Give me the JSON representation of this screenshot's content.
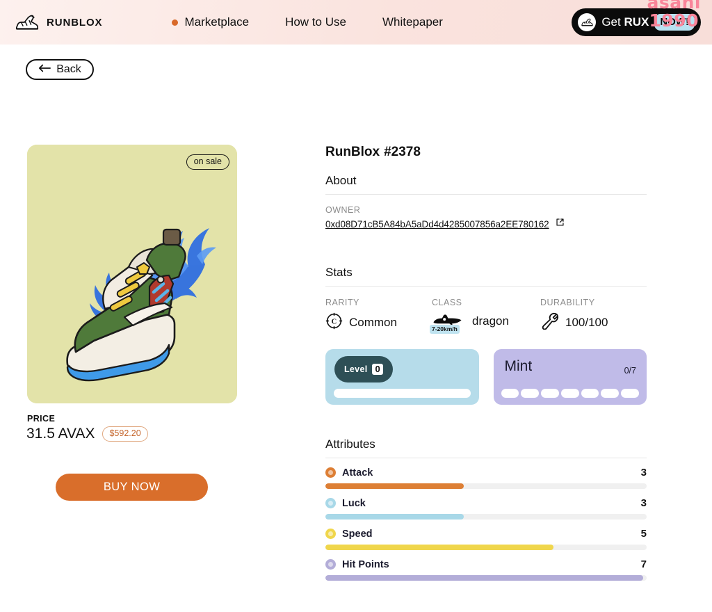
{
  "header": {
    "brand_name": "RUNBLOX",
    "brand_logo_icon": "sneaker-icon",
    "nav": [
      {
        "label": "Marketplace",
        "active": true
      },
      {
        "label": "How to Use",
        "active": false
      },
      {
        "label": "Whitepaper",
        "active": false
      }
    ],
    "cta": {
      "icon": "sneaker-icon",
      "text_plain": "Get ",
      "text_bold": "RUX",
      "badge": "NOW!"
    },
    "accent_dot_color": "#d9692a",
    "background_color": "#fae3de"
  },
  "back_button": {
    "label": "Back",
    "icon": "arrow-left-icon"
  },
  "nft_card": {
    "sale_badge": "on sale",
    "background_color": "#e3e3a9",
    "art_description": "green-and-white sneaker with yellow laces on blue flames"
  },
  "price": {
    "label": "PRICE",
    "amount": "31.5 AVAX",
    "usd": "$592.20",
    "buy_label": "BUY NOW",
    "buy_color": "#d96e2b"
  },
  "detail": {
    "title": "RunBlox",
    "token_id": "#2378",
    "about_heading": "About",
    "owner_label": "OWNER",
    "owner_address": "0xd08D71cB5A84bA5aDd4d4285007856a2EE780162",
    "external_link_icon": "external-link-icon"
  },
  "stats": {
    "heading": "Stats",
    "items": [
      {
        "label": "RARITY",
        "value": "Common",
        "icon": "rarity-common-icon"
      },
      {
        "label": "CLASS",
        "value": "dragon",
        "icon": "dragon-icon",
        "speed_badge": "7-20km/h"
      },
      {
        "label": "DURABILITY",
        "value": "100/100",
        "icon": "wrench-icon"
      }
    ]
  },
  "level_card": {
    "label": "Level",
    "value": "0",
    "background_color": "#b6dcea",
    "badge_color": "#2e4f56"
  },
  "mint_card": {
    "title": "Mint",
    "count": "0/7",
    "segments": 7,
    "background_color": "#c0bbe8"
  },
  "attributes": {
    "heading": "Attributes",
    "max": 7,
    "items": [
      {
        "name": "Attack",
        "value": 3,
        "percent": 43,
        "color": "#dd7f35"
      },
      {
        "name": "Luck",
        "value": 3,
        "percent": 43,
        "color": "#a8d8e8"
      },
      {
        "name": "Speed",
        "value": 5,
        "percent": 71,
        "color": "#f0d64b"
      },
      {
        "name": "Hit Points",
        "value": 7,
        "percent": 99,
        "color": "#b3add8"
      }
    ]
  },
  "watermark": {
    "line1": "asahi",
    "line2": "1990",
    "color": "#f9859a"
  }
}
